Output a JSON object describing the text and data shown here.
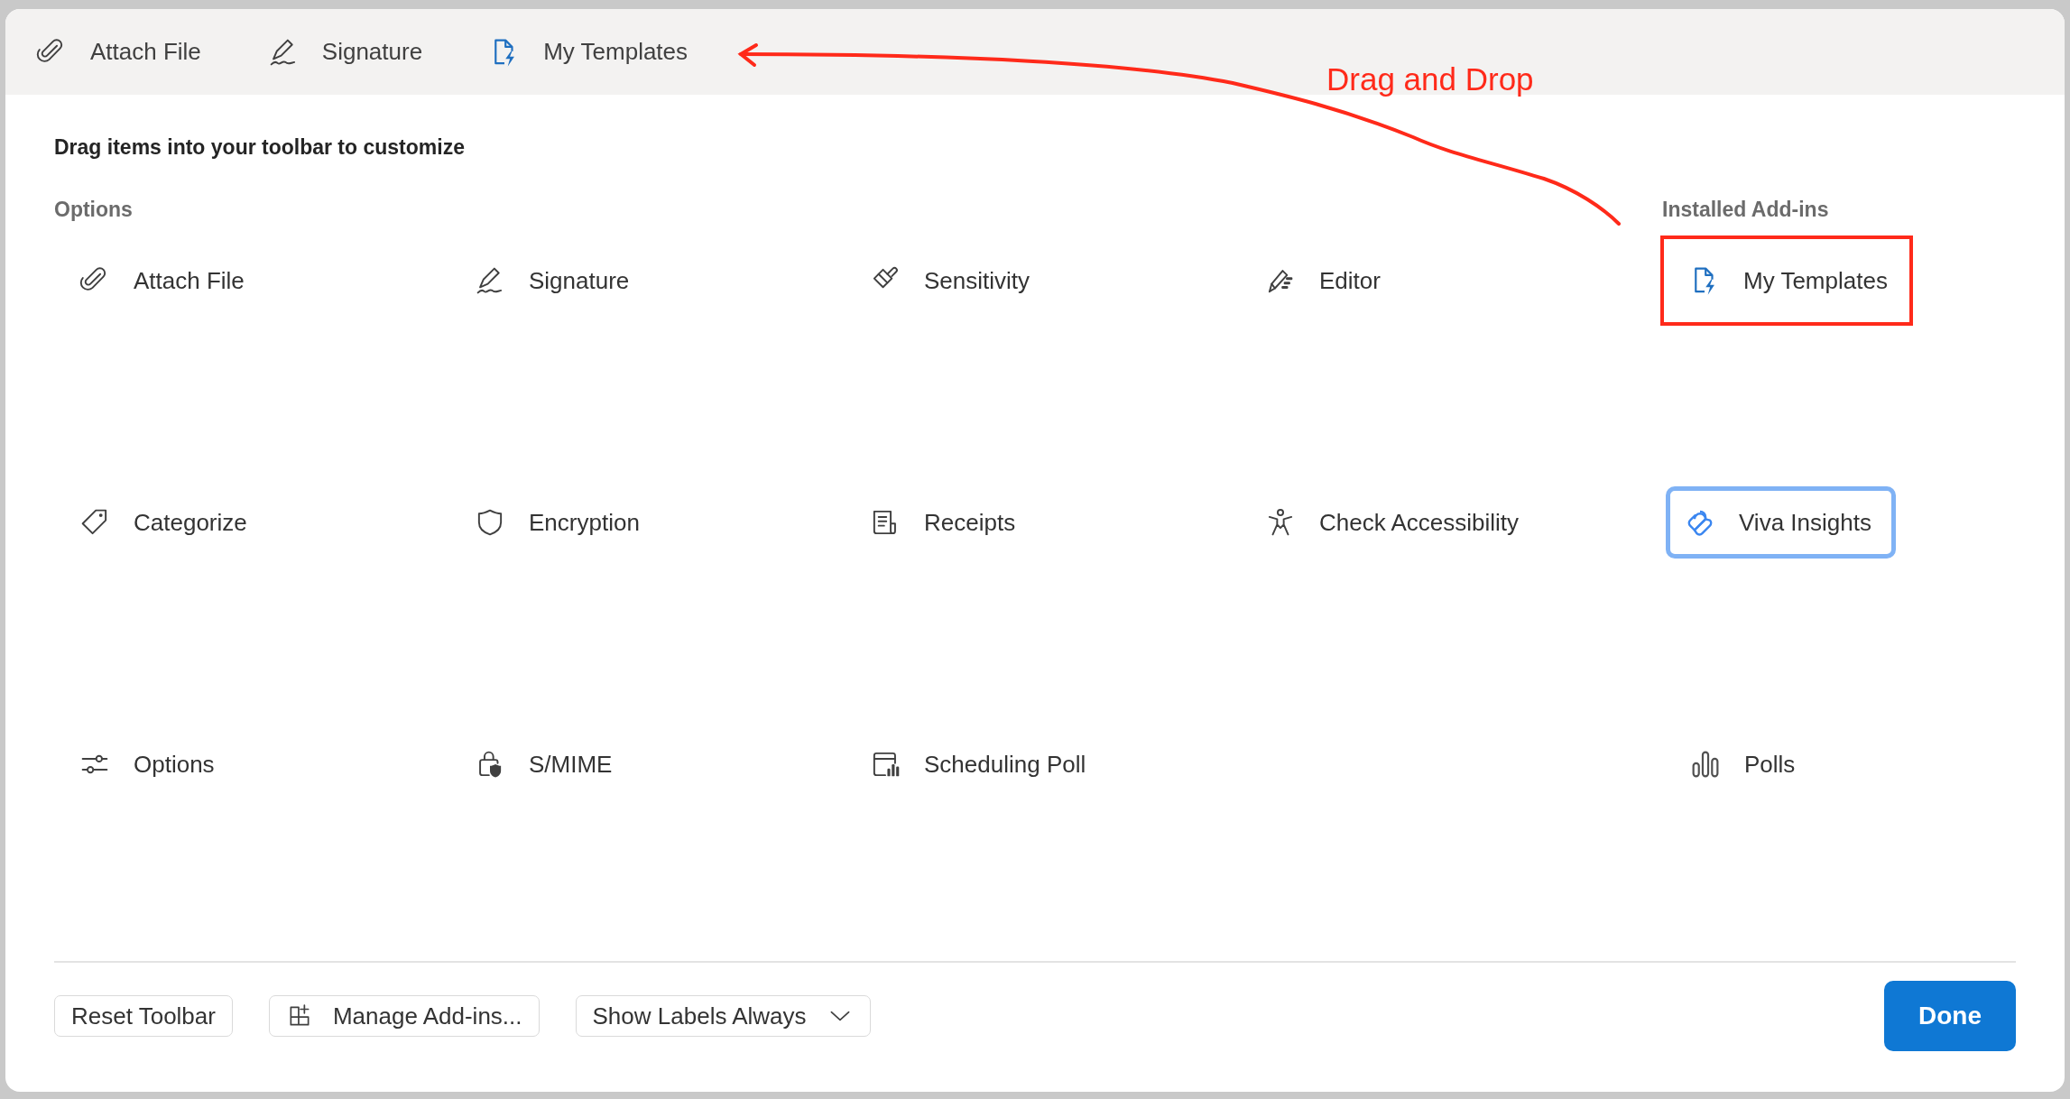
{
  "toolbar": {
    "items": [
      {
        "label": "Attach File",
        "kind": "paperclip"
      },
      {
        "label": "Signature",
        "kind": "signature"
      },
      {
        "label": "My Templates",
        "kind": "doc-bolt"
      }
    ]
  },
  "heading": "Drag items into your toolbar to customize",
  "options": {
    "title": "Options",
    "items": [
      {
        "label": "Attach File",
        "kind": "paperclip"
      },
      {
        "label": "Signature",
        "kind": "signature"
      },
      {
        "label": "Sensitivity",
        "kind": "brush"
      },
      {
        "label": "Editor",
        "kind": "pen"
      },
      {
        "label": "Categorize",
        "kind": "tag"
      },
      {
        "label": "Encryption",
        "kind": "shield"
      },
      {
        "label": "Receipts",
        "kind": "receipt"
      },
      {
        "label": "Check Accessibility",
        "kind": "person"
      },
      {
        "label": "Options",
        "kind": "sliders"
      },
      {
        "label": "S/MIME",
        "kind": "lock"
      },
      {
        "label": "Scheduling Poll",
        "kind": "calendar"
      }
    ]
  },
  "addins": {
    "title": "Installed Add-ins",
    "items": [
      {
        "label": "My Templates",
        "kind": "doc-bolt",
        "highlighted": true,
        "focused": false
      },
      {
        "label": "Viva Insights",
        "kind": "loops",
        "highlighted": false,
        "focused": true
      },
      {
        "label": "Polls",
        "kind": "bars",
        "highlighted": false,
        "focused": false
      }
    ]
  },
  "footer": {
    "buttons": [
      {
        "label": "Reset Toolbar",
        "kind": "plain"
      },
      {
        "label": "Manage Add-ins...",
        "kind": "icon"
      },
      {
        "label": "Show Labels Always",
        "kind": "dropdown"
      },
      {
        "label": "Done",
        "kind": "primary"
      }
    ]
  },
  "annotation": {
    "label": "Drag and Drop"
  }
}
